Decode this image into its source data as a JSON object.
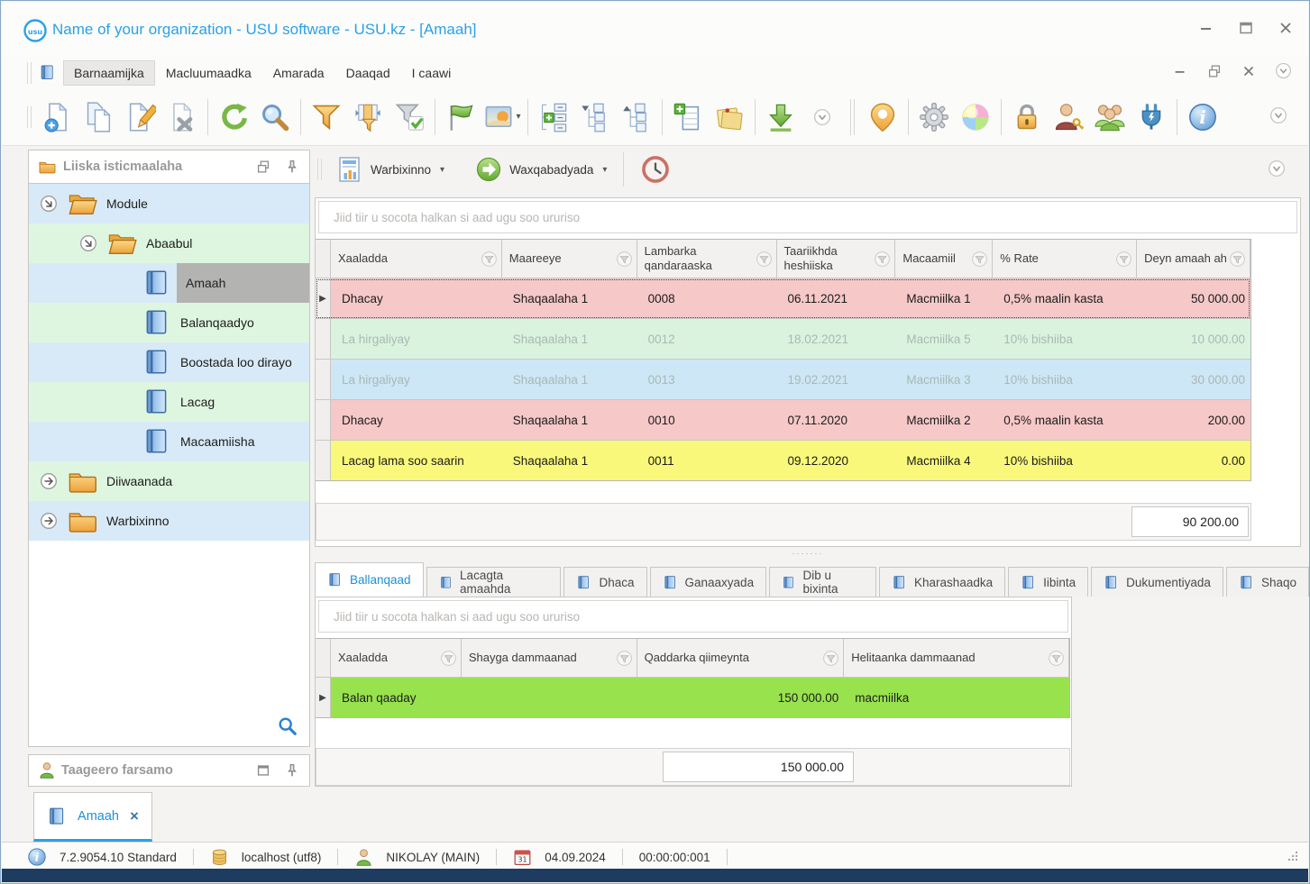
{
  "window": {
    "title": "Name of your organization - USU software - USU.kz - [Amaah]"
  },
  "menu": {
    "items": [
      "Barnaamijka",
      "Macluumaadka",
      "Amarada",
      "Daaqad",
      "I caawi"
    ],
    "active_index": 0
  },
  "toolbar": {
    "buttons": [
      "add-record",
      "copy-record",
      "edit-record",
      "delete-record",
      "sep",
      "refresh",
      "search",
      "sep",
      "filter",
      "filter-panel",
      "filter-check",
      "sep",
      "flag",
      "image",
      "sep",
      "expand-levels",
      "collapse-tree",
      "expand-tree",
      "sep",
      "add-table",
      "notes",
      "sep",
      "export",
      "chevron-small",
      "sep2",
      "map-pin",
      "sep",
      "settings",
      "colors",
      "sep",
      "lock",
      "user-rights",
      "user-groups",
      "plug",
      "sep",
      "info"
    ]
  },
  "sidebar": {
    "title": "Liiska isticmaalaha",
    "support_title": "Taageero farsamo",
    "tree": [
      {
        "label": "Module",
        "level": 0,
        "icon": "folder-open",
        "expand": "expanded",
        "row": "blue"
      },
      {
        "label": "Abaabul",
        "level": 1,
        "icon": "folder-open",
        "expand": "expanded",
        "row": "green"
      },
      {
        "label": "Amaah",
        "level": 2,
        "icon": "book",
        "expand": "",
        "row": "blue",
        "selected": true
      },
      {
        "label": "Balanqaadyo",
        "level": 2,
        "icon": "book",
        "expand": "",
        "row": "green"
      },
      {
        "label": "Boostada loo dirayo",
        "level": 2,
        "icon": "book",
        "expand": "",
        "row": "blue"
      },
      {
        "label": "Lacag",
        "level": 2,
        "icon": "book",
        "expand": "",
        "row": "green"
      },
      {
        "label": "Macaamiisha",
        "level": 2,
        "icon": "book",
        "expand": "",
        "row": "blue"
      },
      {
        "label": "Diiwaanada",
        "level": 0,
        "icon": "folder-closed",
        "expand": "collapsed",
        "row": "green"
      },
      {
        "label": "Warbixinno",
        "level": 0,
        "icon": "folder-closed",
        "expand": "collapsed",
        "row": "blue"
      }
    ]
  },
  "actionbar": {
    "reports_label": "Warbixinno",
    "actions_label": "Waxqabadyada"
  },
  "main_grid": {
    "group_hint": "Jiid tiir u socota halkan si aad ugu soo ururiso",
    "columns": [
      "Xaaladda",
      "Maareeye",
      "Lambarka qandaraaska",
      "Taariikhda heshiiska",
      "Macaamiil",
      "% Rate",
      "Deyn amaah ah"
    ],
    "rows": [
      {
        "cells": [
          "Dhacay",
          "Shaqaalaha 1",
          "0008",
          "06.11.2021",
          "Macmiilka 1",
          "0,5% maalin kasta",
          "50 000.00"
        ],
        "color": "pink",
        "selected": true,
        "marker": true,
        "dim": false
      },
      {
        "cells": [
          "La hirgaliyay",
          "Shaqaalaha 1",
          "0012",
          "18.02.2021",
          "Macmiilka 5",
          "10% bishiiba",
          "10 000.00"
        ],
        "color": "green",
        "selected": false,
        "marker": false,
        "dim": true
      },
      {
        "cells": [
          "La hirgaliyay",
          "Shaqaalaha 1",
          "0013",
          "19.02.2021",
          "Macmiilka 3",
          "10% bishiiba",
          "30 000.00"
        ],
        "color": "blue",
        "selected": false,
        "marker": false,
        "dim": true
      },
      {
        "cells": [
          "Dhacay",
          "Shaqaalaha 1",
          "0010",
          "07.11.2020",
          "Macmiilka 2",
          "0,5% maalin kasta",
          "200.00"
        ],
        "color": "pink",
        "selected": false,
        "marker": false,
        "dim": false
      },
      {
        "cells": [
          "Lacag lama soo saarin",
          "Shaqaalaha 1",
          "0011",
          "09.12.2020",
          "Macmiilka 4",
          "10% bishiiba",
          "0.00"
        ],
        "color": "yellow",
        "selected": false,
        "marker": false,
        "dim": false
      }
    ],
    "total": "90 200.00"
  },
  "detail_section": {
    "tabs": [
      "Ballanqaad",
      "Lacagta amaahda",
      "Dhaca",
      "Ganaaxyada",
      "Dib u bixinta",
      "Kharashaadka",
      "Iibinta",
      "Dukumentiyada",
      "Shaqo"
    ],
    "active_tab": "Ballanqaad",
    "grid": {
      "group_hint": "Jiid tiir u socota halkan si aad ugu soo ururiso",
      "columns": [
        "Xaaladda",
        "Shayga dammaanad",
        "Qaddarka qiimeynta",
        "Helitaanka dammaanad"
      ],
      "rows": [
        {
          "cells": [
            "Balan qaaday",
            "",
            "150 000.00",
            "macmiilka"
          ],
          "color": "lime",
          "selected": false,
          "marker": true,
          "dim": false
        }
      ],
      "total": "150 000.00"
    }
  },
  "doc_tabs": [
    {
      "label": "Amaah",
      "close": "×"
    }
  ],
  "statusbar": {
    "version": "7.2.9054.10 Standard",
    "database": "localhost (utf8)",
    "user": "NIKOLAY (MAIN)",
    "date": "04.09.2024",
    "time": "00:00:00:001"
  }
}
